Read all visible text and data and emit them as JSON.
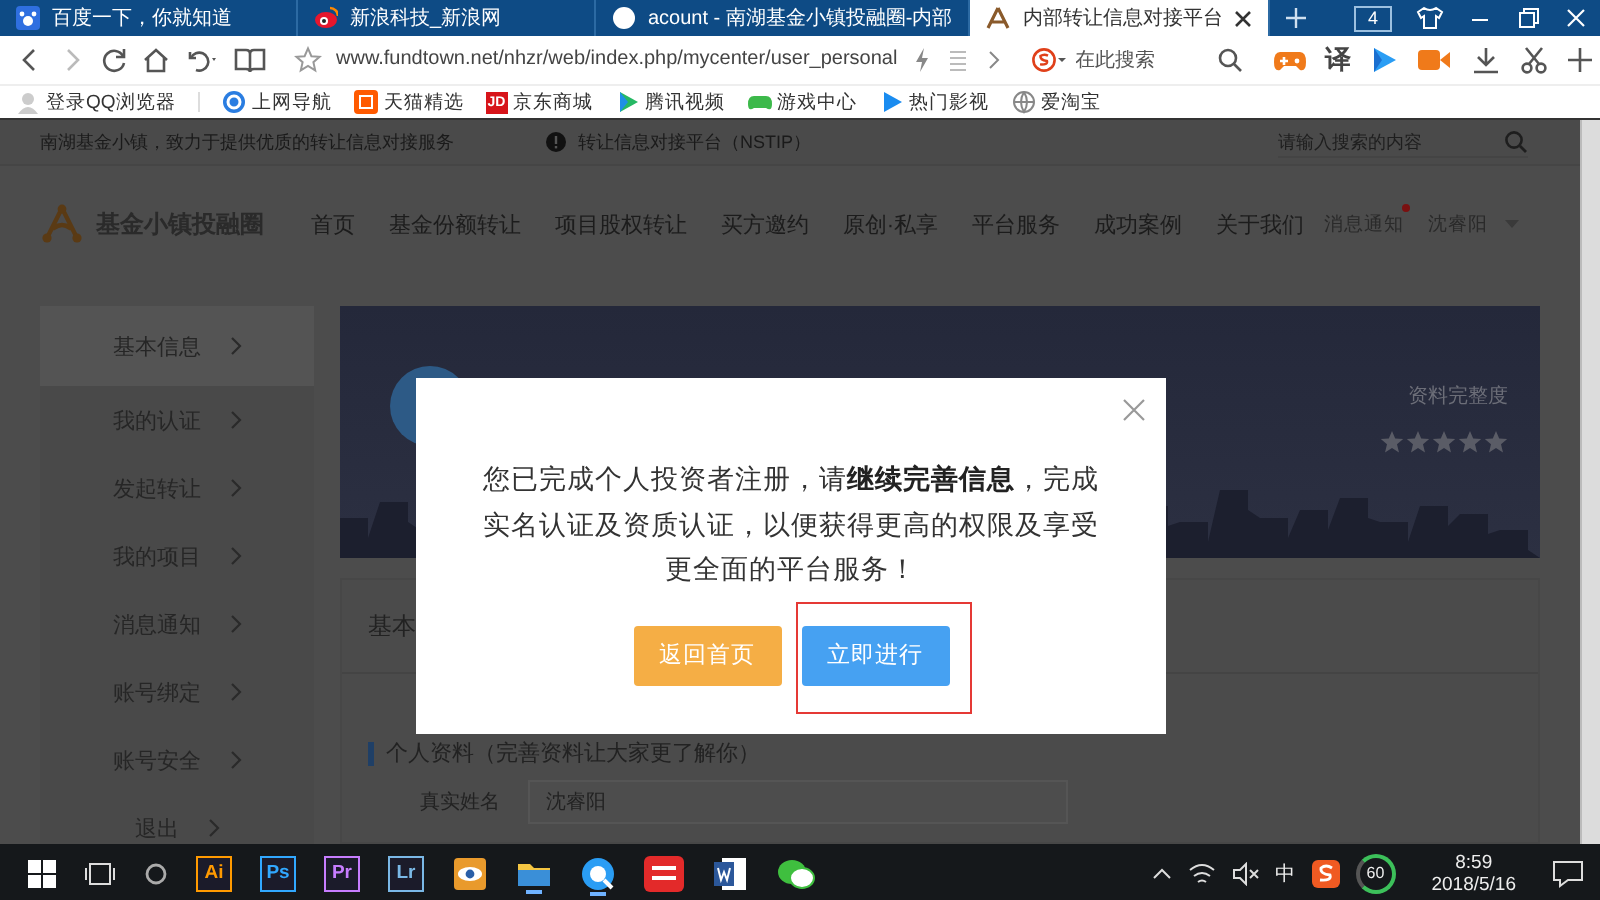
{
  "browser": {
    "tabs": [
      {
        "title": "百度一下，你就知道",
        "selected": false
      },
      {
        "title": "新浪科技_新浪网",
        "selected": false
      },
      {
        "title": "acount - 南湖基金小镇投融圈-内部",
        "selected": false
      },
      {
        "title": "内部转让信息对接平台",
        "selected": true
      }
    ],
    "tab_count": "4",
    "url": "www.fundtown.net/nhzr/web/index.php/mycenter/user_personal",
    "search": {
      "placeholder": "在此搜索"
    },
    "translate": "译",
    "bookmarks": [
      "登录QQ浏览器",
      "上网导航",
      "天猫精选",
      "京东商城",
      "腾讯视频",
      "游戏中心",
      "热门影视",
      "爱淘宝"
    ],
    "jd_badge": "JD"
  },
  "page": {
    "top_bar": {
      "slogan": "南湖基金小镇，致力于提供优质的转让信息对接服务",
      "platform": "转让信息对接平台（NSTIP）",
      "search": {
        "placeholder": "请输入搜索的内容"
      }
    },
    "header": {
      "logo": "基金小镇投融圈",
      "nav": [
        "首页",
        "基金份额转让",
        "项目股权转让",
        "买方邀约",
        "原创·私享",
        "平台服务",
        "成功案例",
        "关于我们"
      ],
      "notifications": "消息通知",
      "has_unread": true,
      "user": "沈睿阳"
    },
    "sidebar": [
      {
        "label": "基本信息",
        "selected": true
      },
      {
        "label": "我的认证",
        "selected": false
      },
      {
        "label": "发起转让",
        "selected": false
      },
      {
        "label": "我的项目",
        "selected": false
      },
      {
        "label": "消息通知",
        "selected": false
      },
      {
        "label": "账号绑定",
        "selected": false
      },
      {
        "label": "账号安全",
        "selected": false
      },
      {
        "label": "退出",
        "selected": false
      }
    ],
    "banner": {
      "label": "资料完整度",
      "stars": 0
    },
    "content": {
      "title": "基本",
      "section": "个人资料（完善资料让大家更了解你）",
      "fields": [
        {
          "label": "真实姓名",
          "value": "沈睿阳"
        }
      ]
    }
  },
  "dialog": {
    "message_lines": [
      "您已完成个人投资者注册，请**继续完善信息**，完成",
      "实名认证及资质认证，以便获得更高的权限及享受",
      "更全面的平台服务！"
    ],
    "buttons": [
      {
        "label": "返回首页",
        "kind": "secondary",
        "highlighted": false
      },
      {
        "label": "立即进行",
        "kind": "primary",
        "highlighted": true
      }
    ]
  },
  "taskbar": {
    "tiles": [
      {
        "label": "Ai",
        "color": "#ff9a00"
      },
      {
        "label": "Ps",
        "color": "#31a8ff"
      },
      {
        "label": "Pr",
        "color": "#c77dff"
      },
      {
        "label": "Lr",
        "color": "#7ab8e6"
      }
    ],
    "ime": "中",
    "battery": "60",
    "time": "8:59",
    "date": "2018/5/16"
  }
}
